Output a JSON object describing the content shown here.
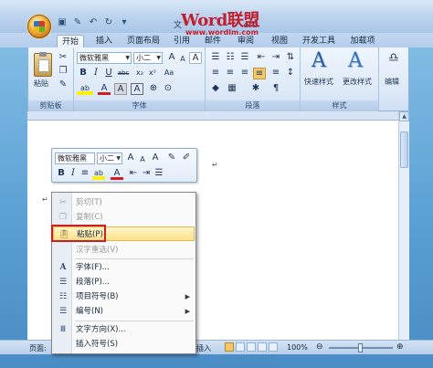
{
  "window": {
    "title_text": "文档1 - Microsoft Word",
    "title_visible_prefix": "文",
    "title_visible_suffix": "ord"
  },
  "watermark": {
    "brand": "Word联盟",
    "url": "www.wordlm.com"
  },
  "quick_access": [
    "save-icon",
    "format-painter-icon",
    "undo-icon",
    "redo-icon",
    "customize-icon"
  ],
  "tabs": [
    {
      "label": "开始",
      "active": true
    },
    {
      "label": "插入"
    },
    {
      "label": "页面布局"
    },
    {
      "label": "引用"
    },
    {
      "label": "邮件"
    },
    {
      "label": "审阅"
    },
    {
      "label": "视图"
    },
    {
      "label": "开发工具"
    },
    {
      "label": "加载项"
    }
  ],
  "ribbon": {
    "clipboard": {
      "group_label": "剪贴板",
      "paste_label": "粘贴"
    },
    "font": {
      "group_label": "字体",
      "font_name": "微软雅黑",
      "font_size": "小二",
      "bold": "B",
      "italic": "I",
      "underline": "U",
      "strike": "abc",
      "sub": "x₂",
      "sup": "x²",
      "aa": "Aa",
      "clear": "A",
      "grow": "A",
      "shrink": "A",
      "color": "A",
      "highlight": "ab"
    },
    "paragraph": {
      "group_label": "段落"
    },
    "styles": {
      "group_label": "样式",
      "quick_styles_label": "快速样式",
      "change_styles_label": "更改样式"
    },
    "editing": {
      "label": "编辑"
    }
  },
  "mini_toolbar": {
    "font_name": "微软雅黑",
    "font_size": "小二",
    "bold": "B",
    "italic": "I",
    "grow": "A",
    "shrink": "A",
    "color": "A"
  },
  "context_menu": {
    "items": [
      {
        "icon": "scissors-icon",
        "label": "剪切(T)",
        "disabled": true
      },
      {
        "icon": "copy-icon",
        "label": "复制(C)",
        "disabled": true
      },
      {
        "icon": "paste-icon",
        "label": "粘贴(P)",
        "highlighted": true
      },
      {
        "icon": "",
        "label": "汉字重选(V)",
        "disabled": true
      },
      {
        "icon": "font-icon",
        "label": "字体(F)..."
      },
      {
        "icon": "paragraph-icon",
        "label": "段落(P)..."
      },
      {
        "icon": "bullets-icon",
        "label": "项目符号(B)",
        "submenu": true
      },
      {
        "icon": "numbering-icon",
        "label": "编号(N)",
        "submenu": true
      },
      {
        "icon": "text-direction-icon",
        "label": "文字方向(X)..."
      },
      {
        "icon": "",
        "label": "插入符号(S)"
      }
    ]
  },
  "statusbar": {
    "page_label": "页面:",
    "insert_label": "插入",
    "zoom": "100%"
  },
  "colors": {
    "accent": "#2a5ea6",
    "highlight_box": "#d21c24",
    "menu_highlight": "#ffe38c"
  }
}
